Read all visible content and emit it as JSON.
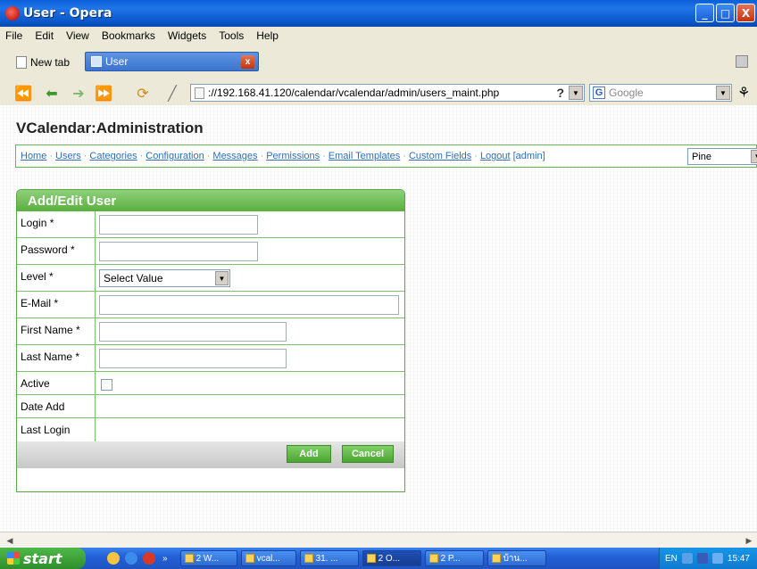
{
  "window": {
    "title": "User - Opera",
    "minimize": "_",
    "maximize": "□",
    "close": "X"
  },
  "menu": [
    "File",
    "Edit",
    "View",
    "Bookmarks",
    "Widgets",
    "Tools",
    "Help"
  ],
  "tabs": {
    "new_tab": "New tab",
    "active_tab": "User",
    "close_glyph": "x"
  },
  "address": {
    "url": "://192.168.41.120/calendar/vcalendar/admin/users_maint.php",
    "help": "?",
    "search_engine": "G",
    "search_placeholder": "Google"
  },
  "page": {
    "title": "VCalendar:Administration",
    "nav": [
      "Home",
      "Users",
      "Categories",
      "Configuration",
      "Messages",
      "Permissions",
      "Email Templates",
      "Custom Fields",
      "Logout"
    ],
    "nav_user": "[admin]",
    "style_select": "Pine"
  },
  "form": {
    "heading": "Add/Edit User",
    "labels": {
      "login": "Login *",
      "password": "Password *",
      "level": "Level *",
      "email": "E-Mail *",
      "first_name": "First Name *",
      "last_name": "Last Name *",
      "active": "Active",
      "date_add": "Date Add",
      "last_login": "Last Login"
    },
    "level_value": "Select Value",
    "active_checked": false,
    "add_button": "Add",
    "cancel_button": "Cancel"
  },
  "taskbar": {
    "start": "start",
    "tasks": [
      "2 W...",
      "vcal...",
      "31. ...",
      "2 O...",
      "2 P...",
      "บ้าน..."
    ],
    "active_task_index": 3,
    "lang": "EN",
    "clock": "15:47"
  },
  "colors": {
    "accent_green": "#5aaf3e",
    "link_blue": "#2f6fb8",
    "xp_blue": "#2261d6"
  }
}
